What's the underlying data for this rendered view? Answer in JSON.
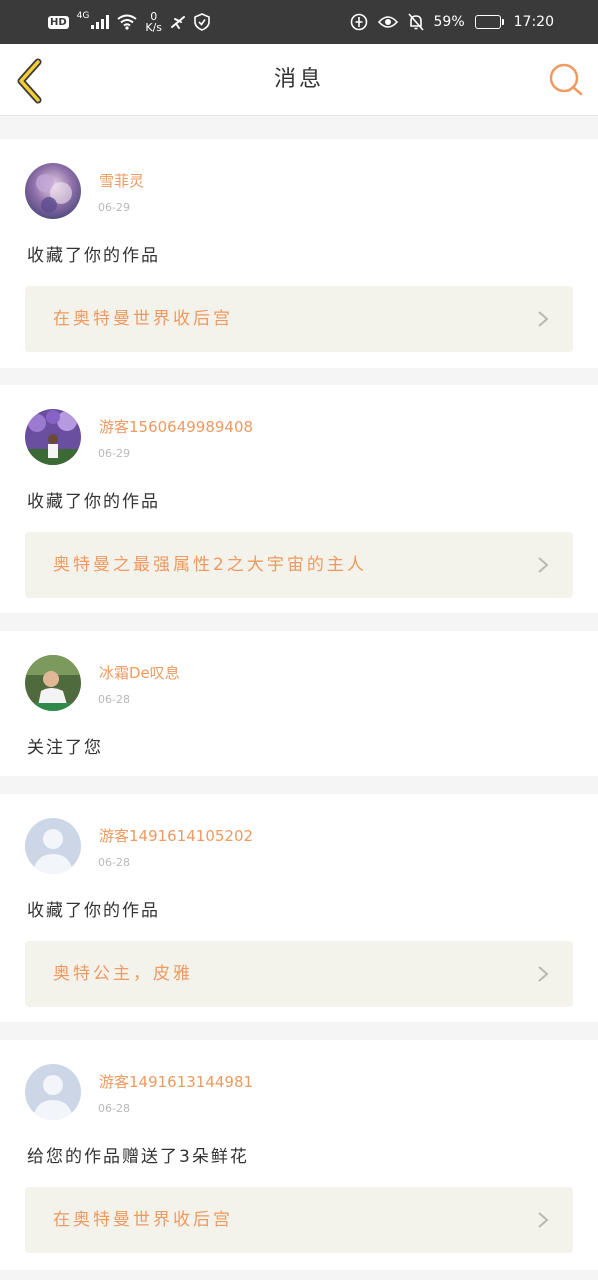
{
  "status_bar": {
    "hd": "HD",
    "network": "4G",
    "speed_value": "0",
    "speed_unit": "K/s",
    "battery": "59%",
    "battery_level": 0.59,
    "time": "17:20"
  },
  "header": {
    "title": "消息",
    "back_icon": "back-chevron-icon",
    "search_icon": "search-icon",
    "accent_color": "#ee9a60"
  },
  "messages": [
    {
      "user": "雪菲灵",
      "date": "06-29",
      "action": "收藏了你的作品",
      "work_title": "在奥特曼世界收后宫",
      "avatar": "photo-avatar-purple-art"
    },
    {
      "user": "游客1560649989408",
      "date": "06-29",
      "action": "收藏了你的作品",
      "work_title": "奥特曼之最强属性2之大宇宙的主人",
      "avatar": "photo-avatar-flowers"
    },
    {
      "user": "冰霜De叹息",
      "date": "06-28",
      "action": "关注了您",
      "avatar": "photo-avatar-person"
    },
    {
      "user": "游客1491614105202",
      "date": "06-28",
      "action": "收藏了你的作品",
      "work_title": "奥特公主，皮雅",
      "avatar": "default-avatar"
    },
    {
      "user": "游客1491613144981",
      "date": "06-28",
      "action": "给您的作品赠送了3朵鲜花",
      "work_title": "在奥特曼世界收后宫",
      "avatar": "default-avatar"
    }
  ]
}
